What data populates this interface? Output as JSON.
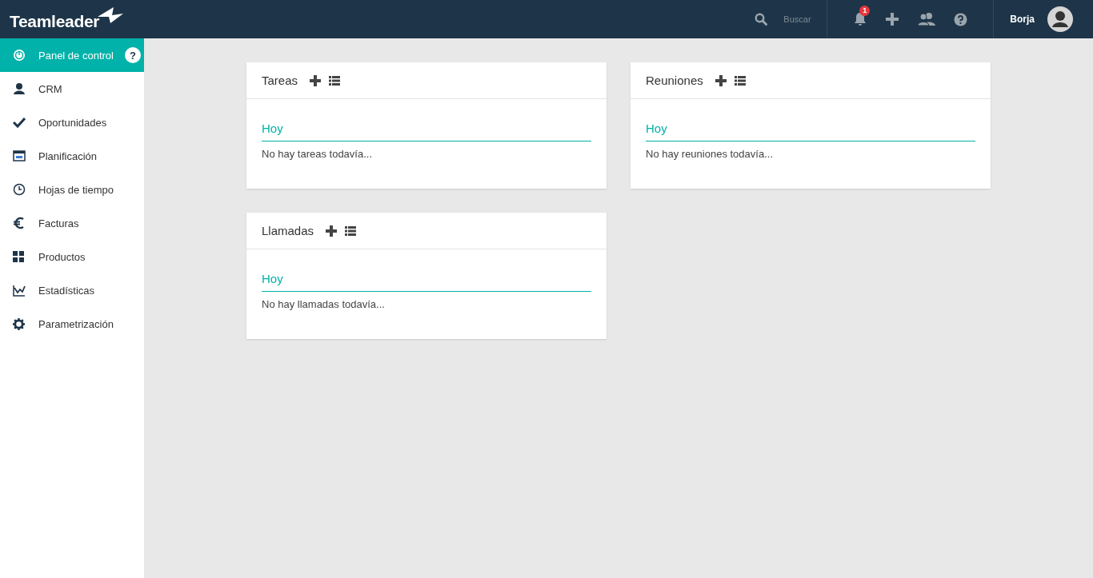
{
  "topbar": {
    "logo": "Teamleader",
    "search": {
      "placeholder": "Buscar"
    },
    "notifications": {
      "count": "1"
    },
    "user": {
      "name": "Borja"
    }
  },
  "sidebar": {
    "items": [
      {
        "label": "Panel de control",
        "kind": "dashboard",
        "selected": true,
        "help": "?"
      },
      {
        "label": "CRM",
        "kind": "person",
        "selected": false
      },
      {
        "label": "Oportunidades",
        "kind": "check",
        "selected": false
      },
      {
        "label": "Planificación",
        "kind": "calendar",
        "selected": false
      },
      {
        "label": "Hojas de tiempo",
        "kind": "clock",
        "selected": false
      },
      {
        "label": "Facturas",
        "kind": "euro",
        "selected": false
      },
      {
        "label": "Productos",
        "kind": "grid",
        "selected": false
      },
      {
        "label": "Estadísticas",
        "kind": "chart",
        "selected": false
      },
      {
        "label": "Parametrización",
        "kind": "gear",
        "selected": false
      }
    ]
  },
  "widgets": [
    {
      "title": "Tareas",
      "section": "Hoy",
      "empty": "No hay tareas todavía..."
    },
    {
      "title": "Reuniones",
      "section": "Hoy",
      "empty": "No hay reuniones todavía..."
    },
    {
      "title": "Llamadas",
      "section": "Hoy",
      "empty": "No hay llamadas todavía..."
    }
  ]
}
